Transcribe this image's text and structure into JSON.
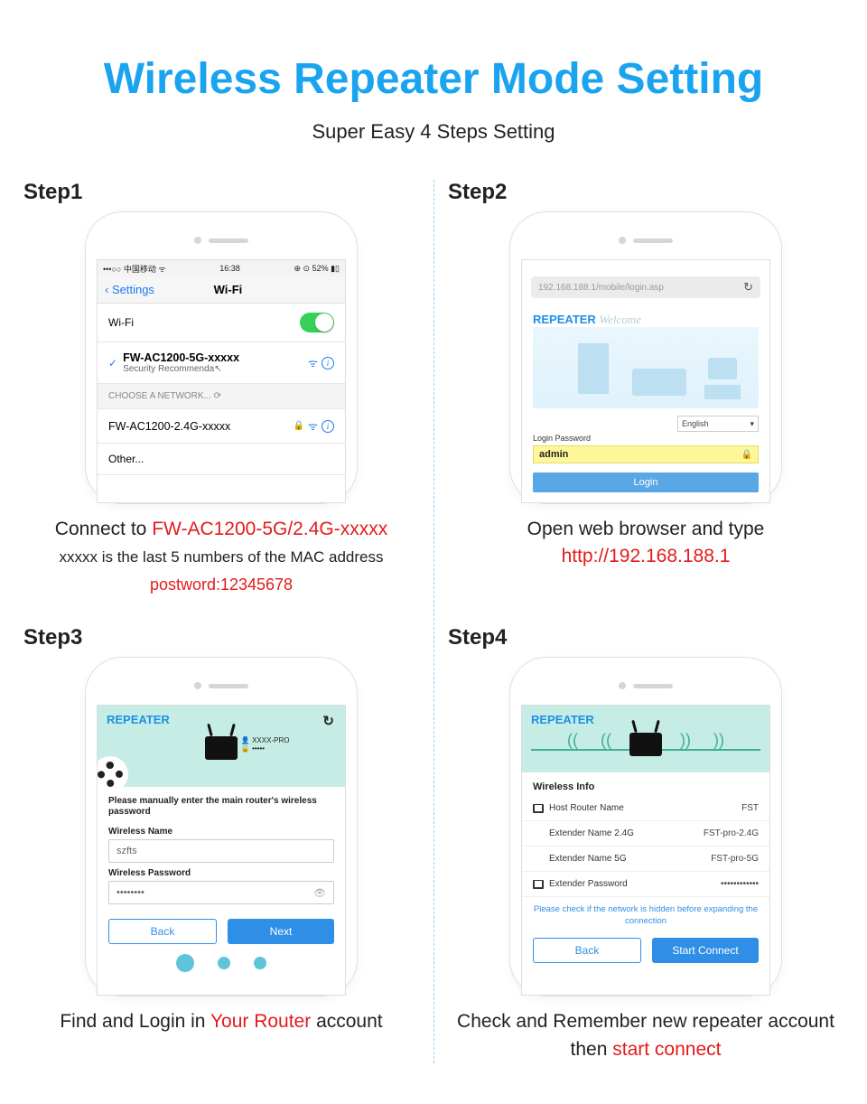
{
  "header": {
    "title": "Wireless Repeater Mode Setting",
    "subtitle": "Super Easy 4 Steps Setting"
  },
  "step1": {
    "label": "Step1",
    "status": {
      "carrier": "•••○○ 中国移动 ᯤ",
      "time": "16:38",
      "right": "⊕ ⊙ 52% ▮▯"
    },
    "nav": {
      "back": "Settings",
      "title": "Wi-Fi"
    },
    "wifi_row_label": "Wi-Fi",
    "connected_net": "FW-AC1200-5G-xxxxx",
    "connected_sub": "Security Recommenda",
    "choose_label": "CHOOSE A NETWORK...",
    "other_net": "FW-AC1200-2.4G-xxxxx",
    "other_row": "Other...",
    "caption_a": "Connect to ",
    "caption_b": "FW-AC1200-5G/2.4G-xxxxx",
    "caption_sub": "xxxxx is the last 5 numbers of the MAC address",
    "caption_pw": "postword:12345678"
  },
  "step2": {
    "label": "Step2",
    "url": "192.168.188.1/mobile/login.asp",
    "repeater": "REPEATER",
    "welcome": "Welcome",
    "language": "English",
    "lp_label": "Login Password",
    "lp_value": "admin",
    "login_btn": "Login",
    "caption_a": "Open web browser and type",
    "caption_b": "http://192.168.188.1"
  },
  "step3": {
    "label": "Step3",
    "repeater": "REPEATER",
    "info_name": "XXXX-PRO",
    "info_pw": "•••••",
    "note": "Please manually enter the main router's wireless password",
    "name_label": "Wireless Name",
    "name_value": "szfts",
    "pw_label": "Wireless Password",
    "pw_value": "••••••••",
    "back": "Back",
    "next": "Next",
    "caption_a": "Find and Login in ",
    "caption_b": "Your Router",
    "caption_c": " account"
  },
  "step4": {
    "label": "Step4",
    "repeater": "REPEATER",
    "section": "Wireless Info",
    "rows": [
      {
        "k": "Host Router Name",
        "v": "FST"
      },
      {
        "k": "Extender Name 2.4G",
        "v": "FST-pro-2.4G"
      },
      {
        "k": "Extender Name 5G",
        "v": "FST-pro-5G"
      },
      {
        "k": "Extender Password",
        "v": "••••••••••••"
      }
    ],
    "warn": "Please check if the network is hidden before expanding the connection",
    "back": "Back",
    "connect": "Start Connect",
    "caption_a": "Check and Remember new repeater account then ",
    "caption_b": "start connect"
  }
}
